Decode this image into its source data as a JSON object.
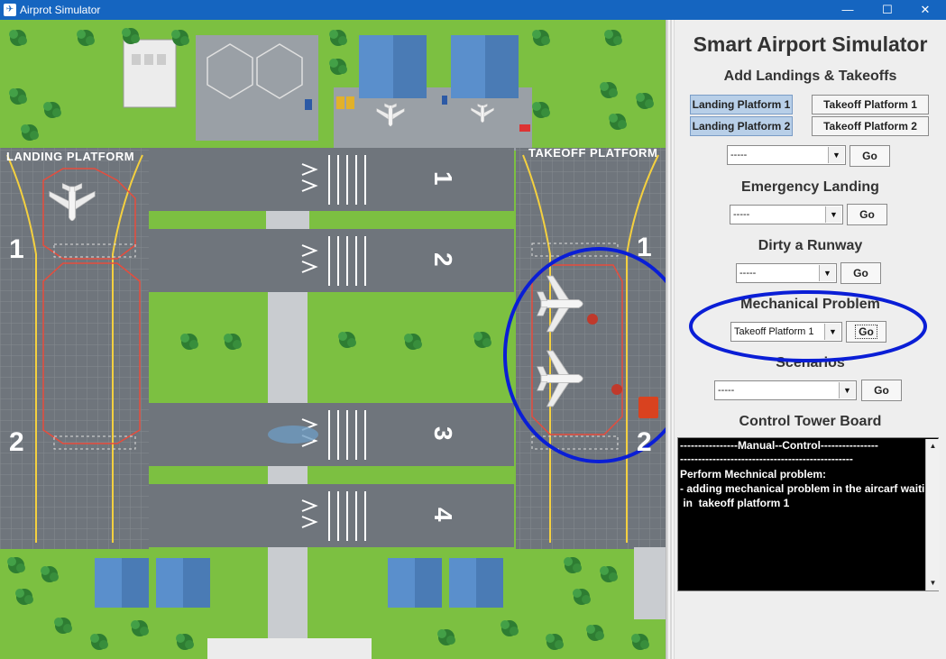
{
  "window": {
    "title": "Airprot Simulator",
    "minimize": "—",
    "maximize": "☐",
    "close": "✕"
  },
  "map": {
    "landing_platform_label": "LANDING  PLATFORM",
    "takeoff_platform_label": "TAKEOFF  PLATFORM",
    "landing_numbers": [
      "1",
      "2"
    ],
    "takeoff_numbers": [
      "1",
      "2"
    ],
    "runway_numbers": [
      "1",
      "2",
      "3",
      "4"
    ]
  },
  "panel": {
    "title": "Smart Airport Simulator",
    "add_section": {
      "heading": "Add Landings & Takeoffs",
      "buttons": [
        {
          "label": "Landing Platform 1"
        },
        {
          "label": "Takeoff Platform 1"
        },
        {
          "label": "Landing Platform 2"
        },
        {
          "label": "Takeoff Platform 2"
        }
      ],
      "combo_value": "-----",
      "go_label": "Go"
    },
    "emergency": {
      "heading": "Emergency Landing",
      "combo_value": "-----",
      "go_label": "Go"
    },
    "dirty": {
      "heading": "Dirty a Runway",
      "combo_value": "-----",
      "go_label": "Go"
    },
    "mechanical": {
      "heading": "Mechanical Problem",
      "combo_value": "Takeoff Platform 1",
      "go_label": "Go"
    },
    "scenarios": {
      "heading": "Scenarios",
      "combo_value": "-----",
      "go_label": "Go"
    },
    "board": {
      "heading": "Control Tower Board",
      "lines": [
        "----------------Manual--Control----------------",
        "------------------------------------------------",
        "Perform Mechnical problem:",
        "- adding mechanical problem in the aircarf waiting",
        " in  takeoff platform 1"
      ]
    }
  },
  "colors": {
    "grass": "#7cc041",
    "asphalt": "#6f757c",
    "title_bar": "#1565c0",
    "annotation": "#0a1ed6",
    "board_bg": "#000000"
  }
}
